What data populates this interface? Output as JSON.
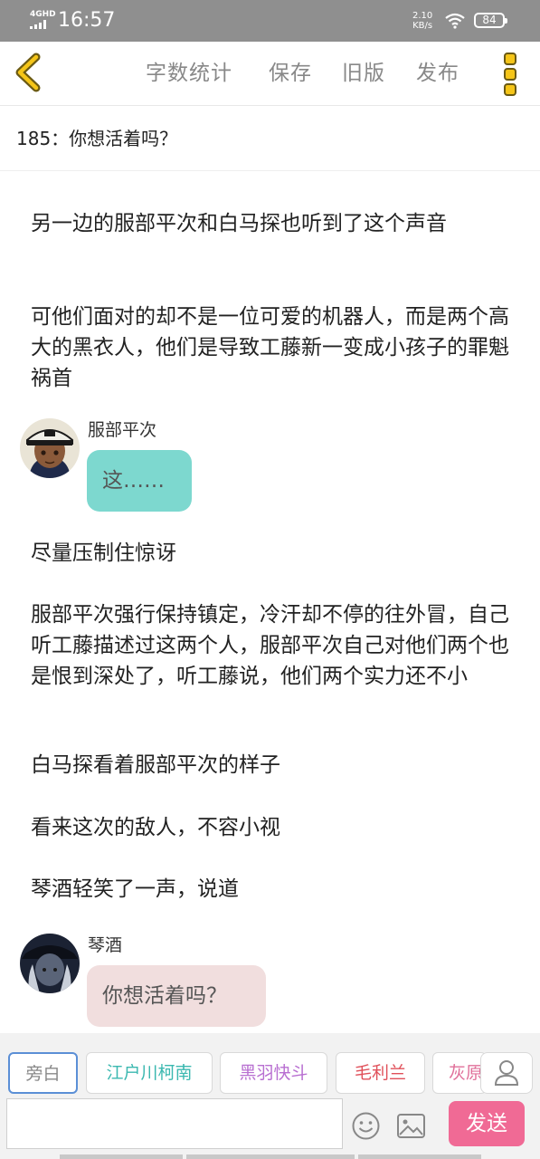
{
  "status_bar": {
    "network": "4GHD",
    "time": "16:57",
    "speed_value": "2.10",
    "speed_unit": "KB/s",
    "battery": "84"
  },
  "nav": {
    "word_count": "字数统计",
    "save": "保存",
    "old_version": "旧版",
    "publish": "发布"
  },
  "chapter_title": "185：你想活着吗？",
  "story": {
    "p1": "另一边的服部平次和白马探也听到了这个声音",
    "p2": "可他们面对的却不是一位可爱的机器人，而是两个高大的黑衣人，他们是导致工藤新一变成小孩子的罪魁祸首",
    "dialog1": {
      "speaker": "服部平次",
      "text": "这……",
      "bubble_color": "#7dd8cf"
    },
    "p3": "尽量压制住惊讶",
    "p4": "服部平次强行保持镇定，冷汗却不停的往外冒，自己听工藤描述过这两个人，服部平次自己对他们两个也是恨到深处了，听工藤说，他们两个实力还不小",
    "p5": "白马探看着服部平次的样子",
    "p6": "看来这次的敌人，不容小视",
    "p7": "琴酒轻笑了一声，说道",
    "dialog2": {
      "speaker": "琴酒",
      "text": "你想活着吗？",
      "bubble_color": "#f1dede"
    }
  },
  "characters": [
    {
      "label": "旁白",
      "color": "#888888"
    },
    {
      "label": "江户川柯南",
      "color": "#3bb8b0"
    },
    {
      "label": "黑羽快斗",
      "color": "#b86fd1"
    },
    {
      "label": "毛利兰",
      "color": "#e0505a"
    },
    {
      "label": "灰原",
      "color": "#e0709a"
    }
  ],
  "input": {
    "placeholder": "",
    "send": "发送"
  },
  "colors": {
    "accent_yellow": "#f5c518",
    "send_pink": "#f06a95",
    "selected_chip_border": "#5b8fd6"
  }
}
